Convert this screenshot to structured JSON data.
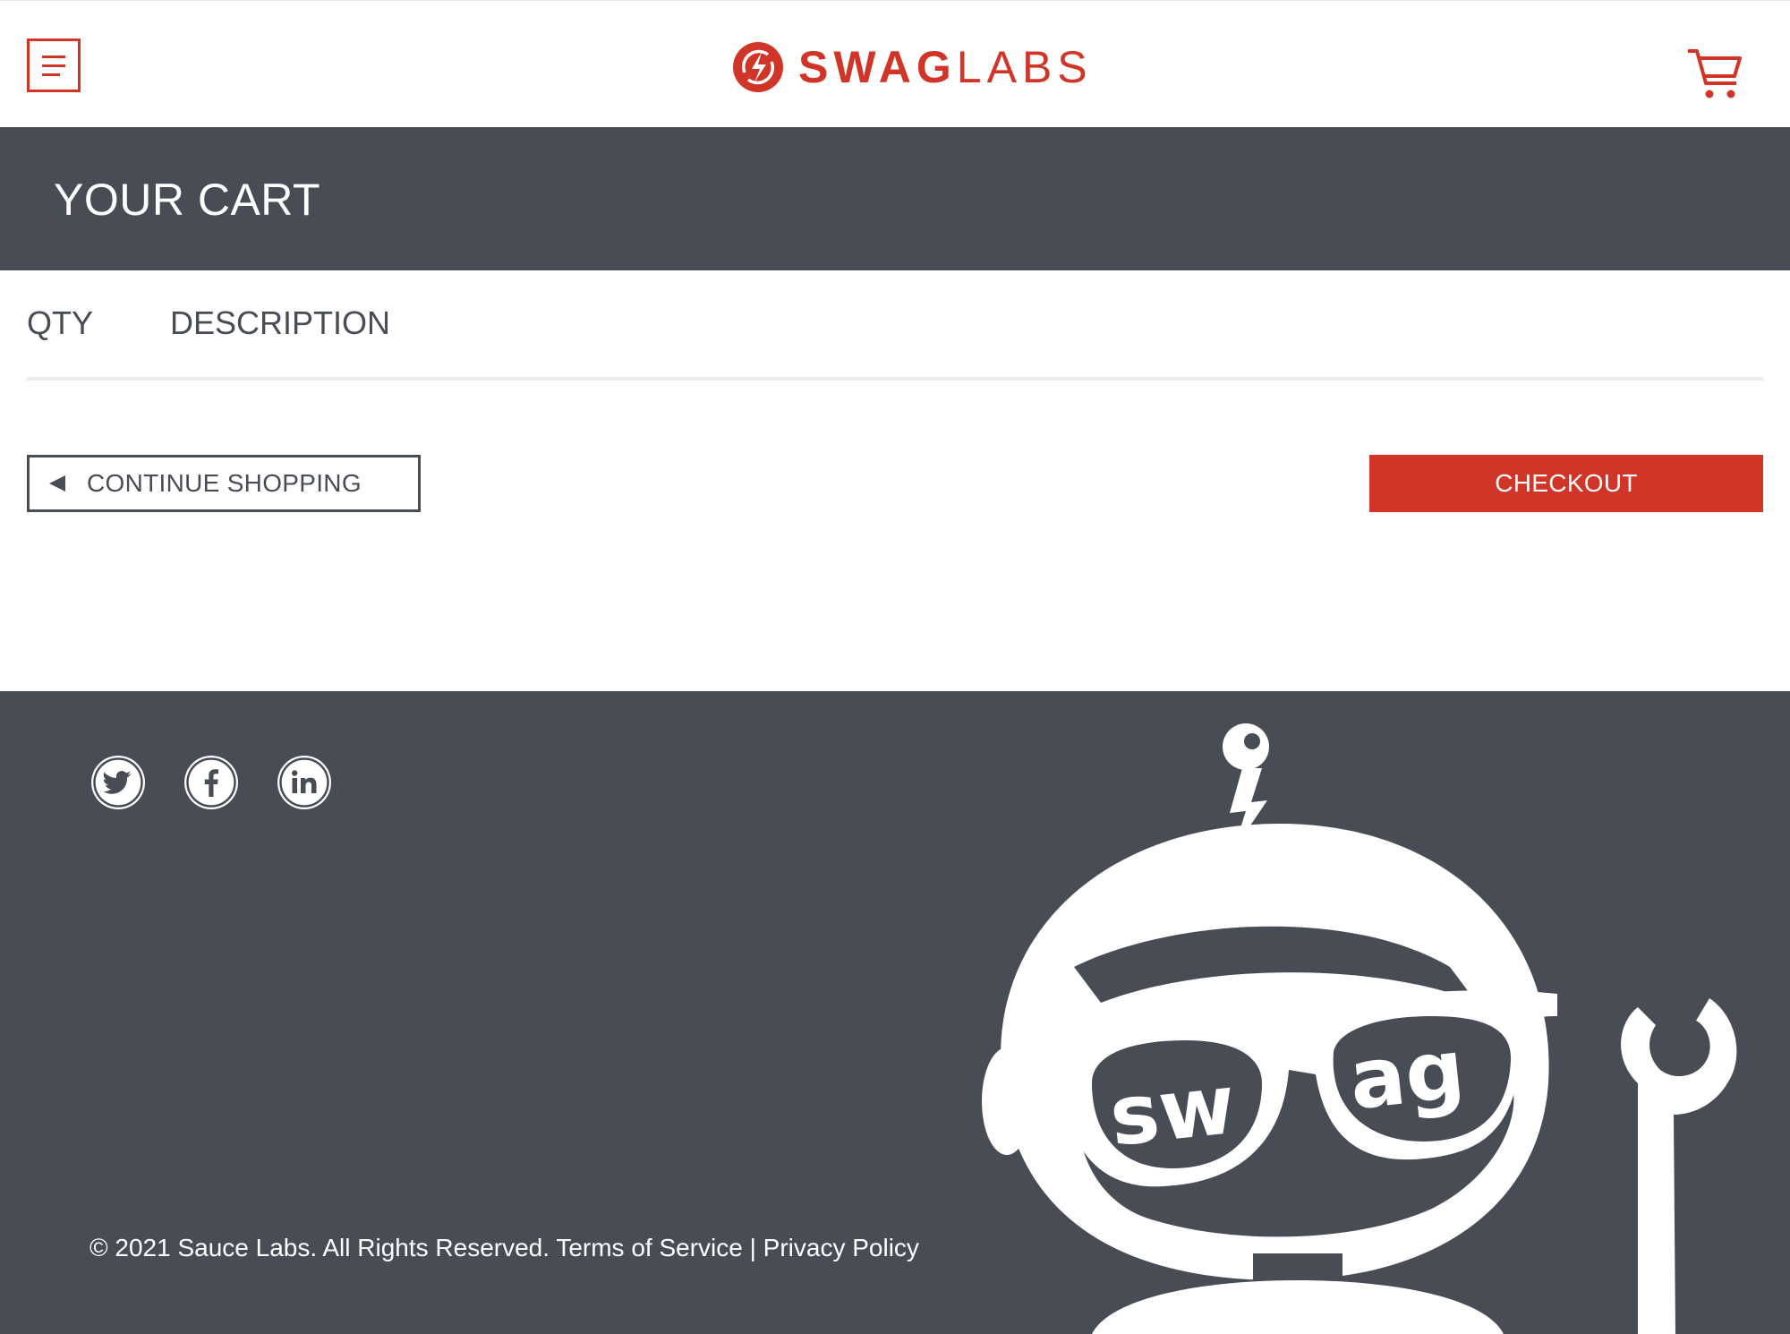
{
  "header": {
    "menu_icon": "hamburger-menu-icon",
    "logo_bold": "SWAG",
    "logo_light": "LABS",
    "cart_icon": "shopping-cart-icon",
    "brand_color": "#d03527"
  },
  "page": {
    "title": "YOUR CART"
  },
  "cart_list": {
    "qty_header": "QTY",
    "description_header": "DESCRIPTION",
    "items": []
  },
  "actions": {
    "continue_label": "CONTINUE SHOPPING",
    "checkout_label": "CHECKOUT"
  },
  "footer": {
    "social": [
      "twitter-icon",
      "facebook-icon",
      "linkedin-icon"
    ],
    "copyright": "© 2021 Sauce Labs. All Rights Reserved.",
    "terms": "Terms of Service",
    "separator": "|",
    "privacy": "Privacy Policy",
    "robot_glasses_left": "sw",
    "robot_glasses_right": "ag",
    "background_color": "#484c55"
  }
}
